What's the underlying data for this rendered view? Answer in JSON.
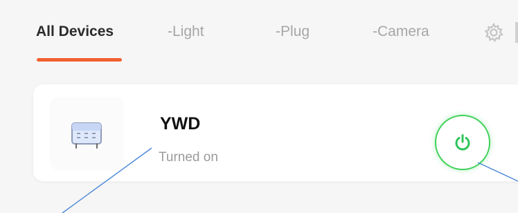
{
  "tabs": [
    {
      "label": "All Devices"
    },
    {
      "label": "-Light"
    },
    {
      "label": "-Plug"
    },
    {
      "label": "-Camera"
    }
  ],
  "device": {
    "name": "YWD",
    "status": "Turned on"
  },
  "colors": {
    "accent": "#f0602e",
    "power_on": "#2ec45a"
  },
  "icons": {
    "settings": "gear-icon",
    "device": "heater-icon",
    "power": "power-icon"
  }
}
